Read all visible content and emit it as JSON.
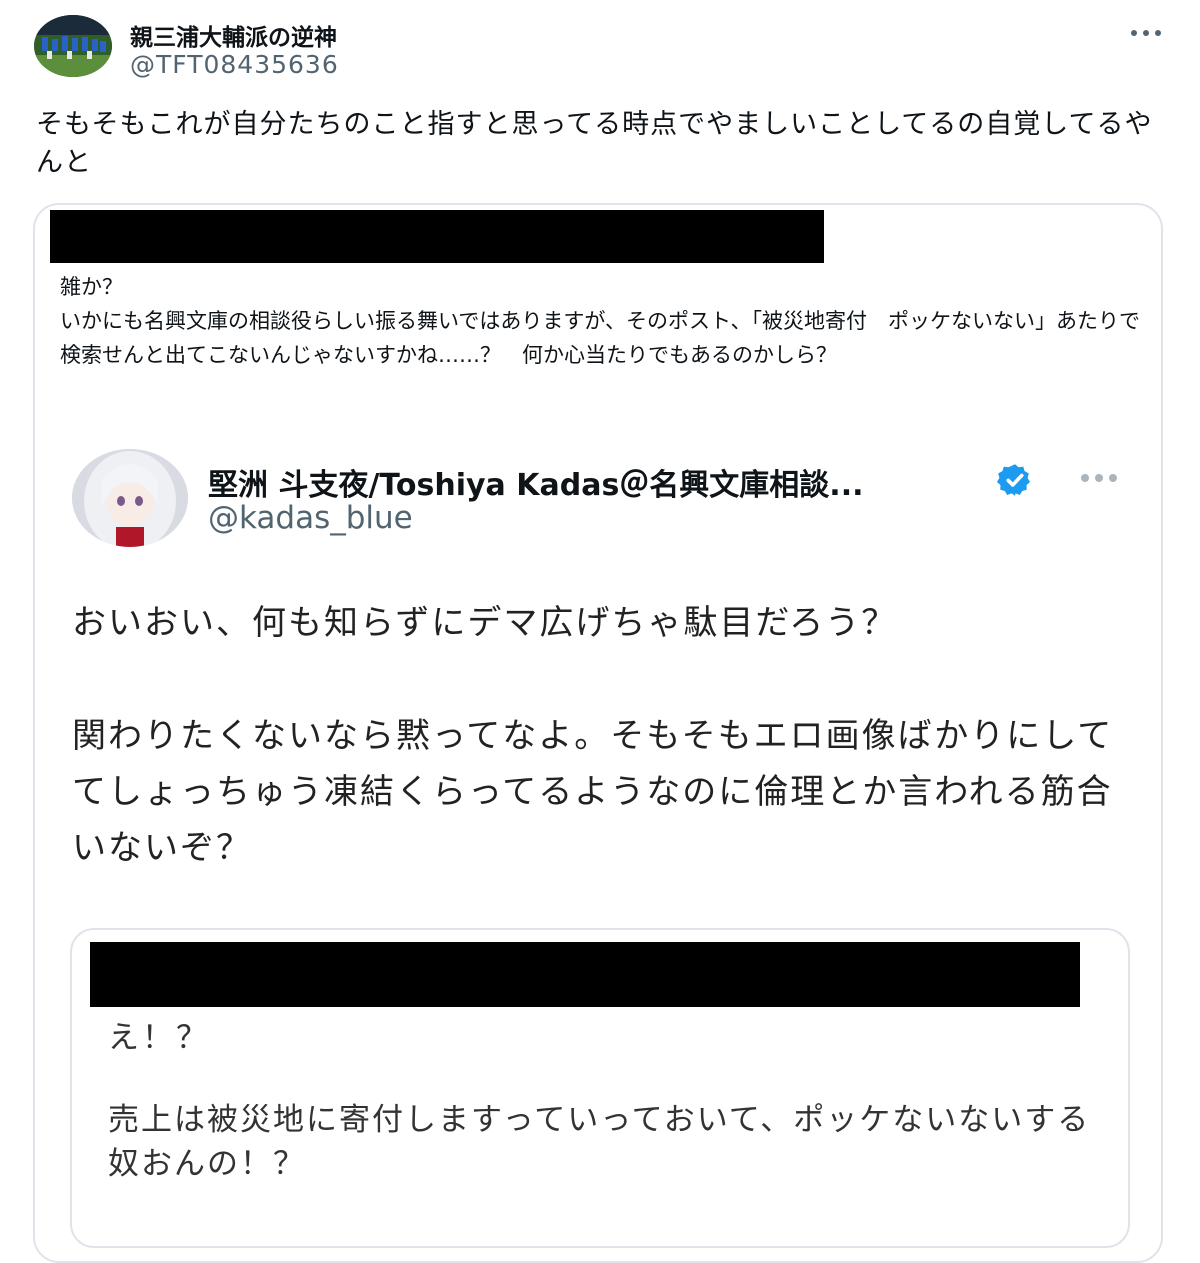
{
  "tweet": {
    "display_name": "親三浦大輔派の逆神",
    "handle": "@TFT08435636",
    "text": "そもそもこれが自分たちのこと指すと思ってる時点でやましいことしてるの自覚してるやんと",
    "more_icon": "more-horizontal-icon"
  },
  "quote": {
    "text": "雑か？\nいかにも名興文庫の相談役らしい振る舞いではありますが、そのポスト、「被災地寄付　ポッケないない」あたりで検索せんと出てこないんじゃないすかね……？　何か心当たりでもあるのかしら？",
    "screenshot": {
      "display_name": "堅洲 斗支夜/Toshiya Kadas＠名興文庫相談...",
      "handle": "@kadas_blue",
      "verified_icon": "verified-badge-icon",
      "more_icon": "more-horizontal-icon",
      "paragraph1": "おいおい、何も知らずにデマ広げちゃ駄目だろう？",
      "paragraph2": "関わりたくないなら黙ってなよ。そもそもエロ画像ばかりにしててしょっちゅう凍結くらってるようなのに倫理とか言われる筋合いないぞ？",
      "nested_quote": {
        "paragraph1": "え！？",
        "paragraph2": "売上は被災地に寄付しますっていっておいて、ポッケないないする奴おんの！？"
      }
    }
  },
  "colors": {
    "text_primary": "#0f1419",
    "text_secondary": "#536471",
    "verified_blue": "#1d9bf0",
    "card_border": "#dfe4ea",
    "redaction": "#000000"
  }
}
